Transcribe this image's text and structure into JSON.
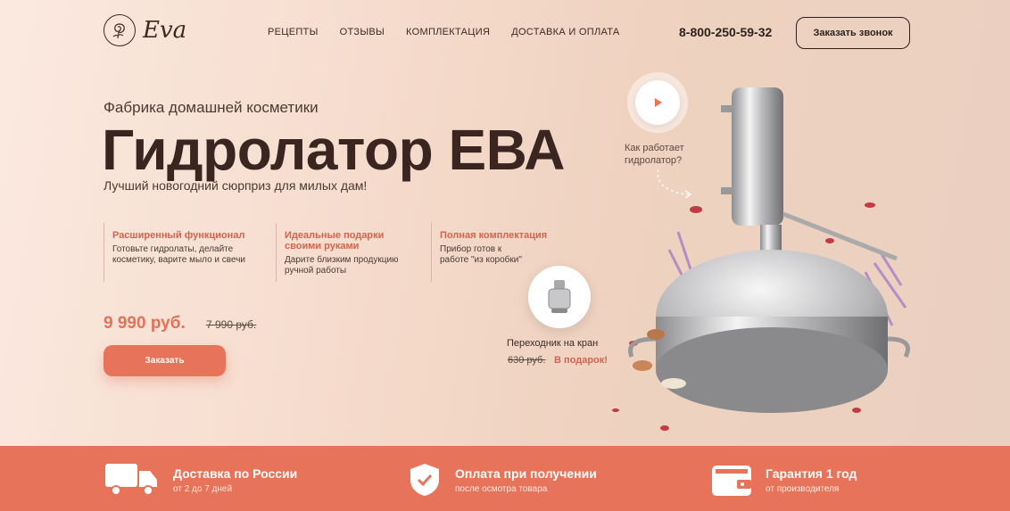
{
  "header": {
    "logo_text": "Eva",
    "nav": [
      "РЕЦЕПТЫ",
      "ОТЗЫВЫ",
      "КОМПЛЕКТАЦИЯ",
      "ДОСТАВКА И ОПЛАТА"
    ],
    "phone": "8-800-250-59-32",
    "callback_label": "Заказать звонок"
  },
  "hero": {
    "subtitle": "Фабрика домашней косметики",
    "title": "Гидролатор ЕВА",
    "tagline": "Лучший новогодний сюрприз для милых дам!",
    "features": [
      {
        "title": "Расширенный функционал",
        "desc": "Готовьте гидролаты, делайте косметику, варите мыло и свечи"
      },
      {
        "title": "Идеальные подарки своими руками",
        "desc": "Дарите близким продукцию ручной работы"
      },
      {
        "title": "Полная комплектация",
        "desc": "Прибор готов к работе \"из коробки\""
      }
    ],
    "price": "9 990 руб.",
    "old_price": "7 990 руб.",
    "order_label": "Заказать"
  },
  "video": {
    "caption_line1": "Как работает",
    "caption_line2": "гидролатор?"
  },
  "adapter": {
    "label": "Переходник на кран",
    "old_price": "630 руб.",
    "gift": "В подарок!"
  },
  "benefits": [
    {
      "icon": "truck-icon",
      "title": "Доставка по России",
      "desc": "от 2 до 7 дней"
    },
    {
      "icon": "shield-check-icon",
      "title": "Оплата при получении",
      "desc": "после осмотра товара"
    },
    {
      "icon": "wallet-icon",
      "title": "Гарантия 1 год",
      "desc": "от производителя"
    }
  ],
  "colors": {
    "accent": "#e7735a",
    "feature_title": "#d0654e",
    "text_dark": "#3a2520"
  }
}
